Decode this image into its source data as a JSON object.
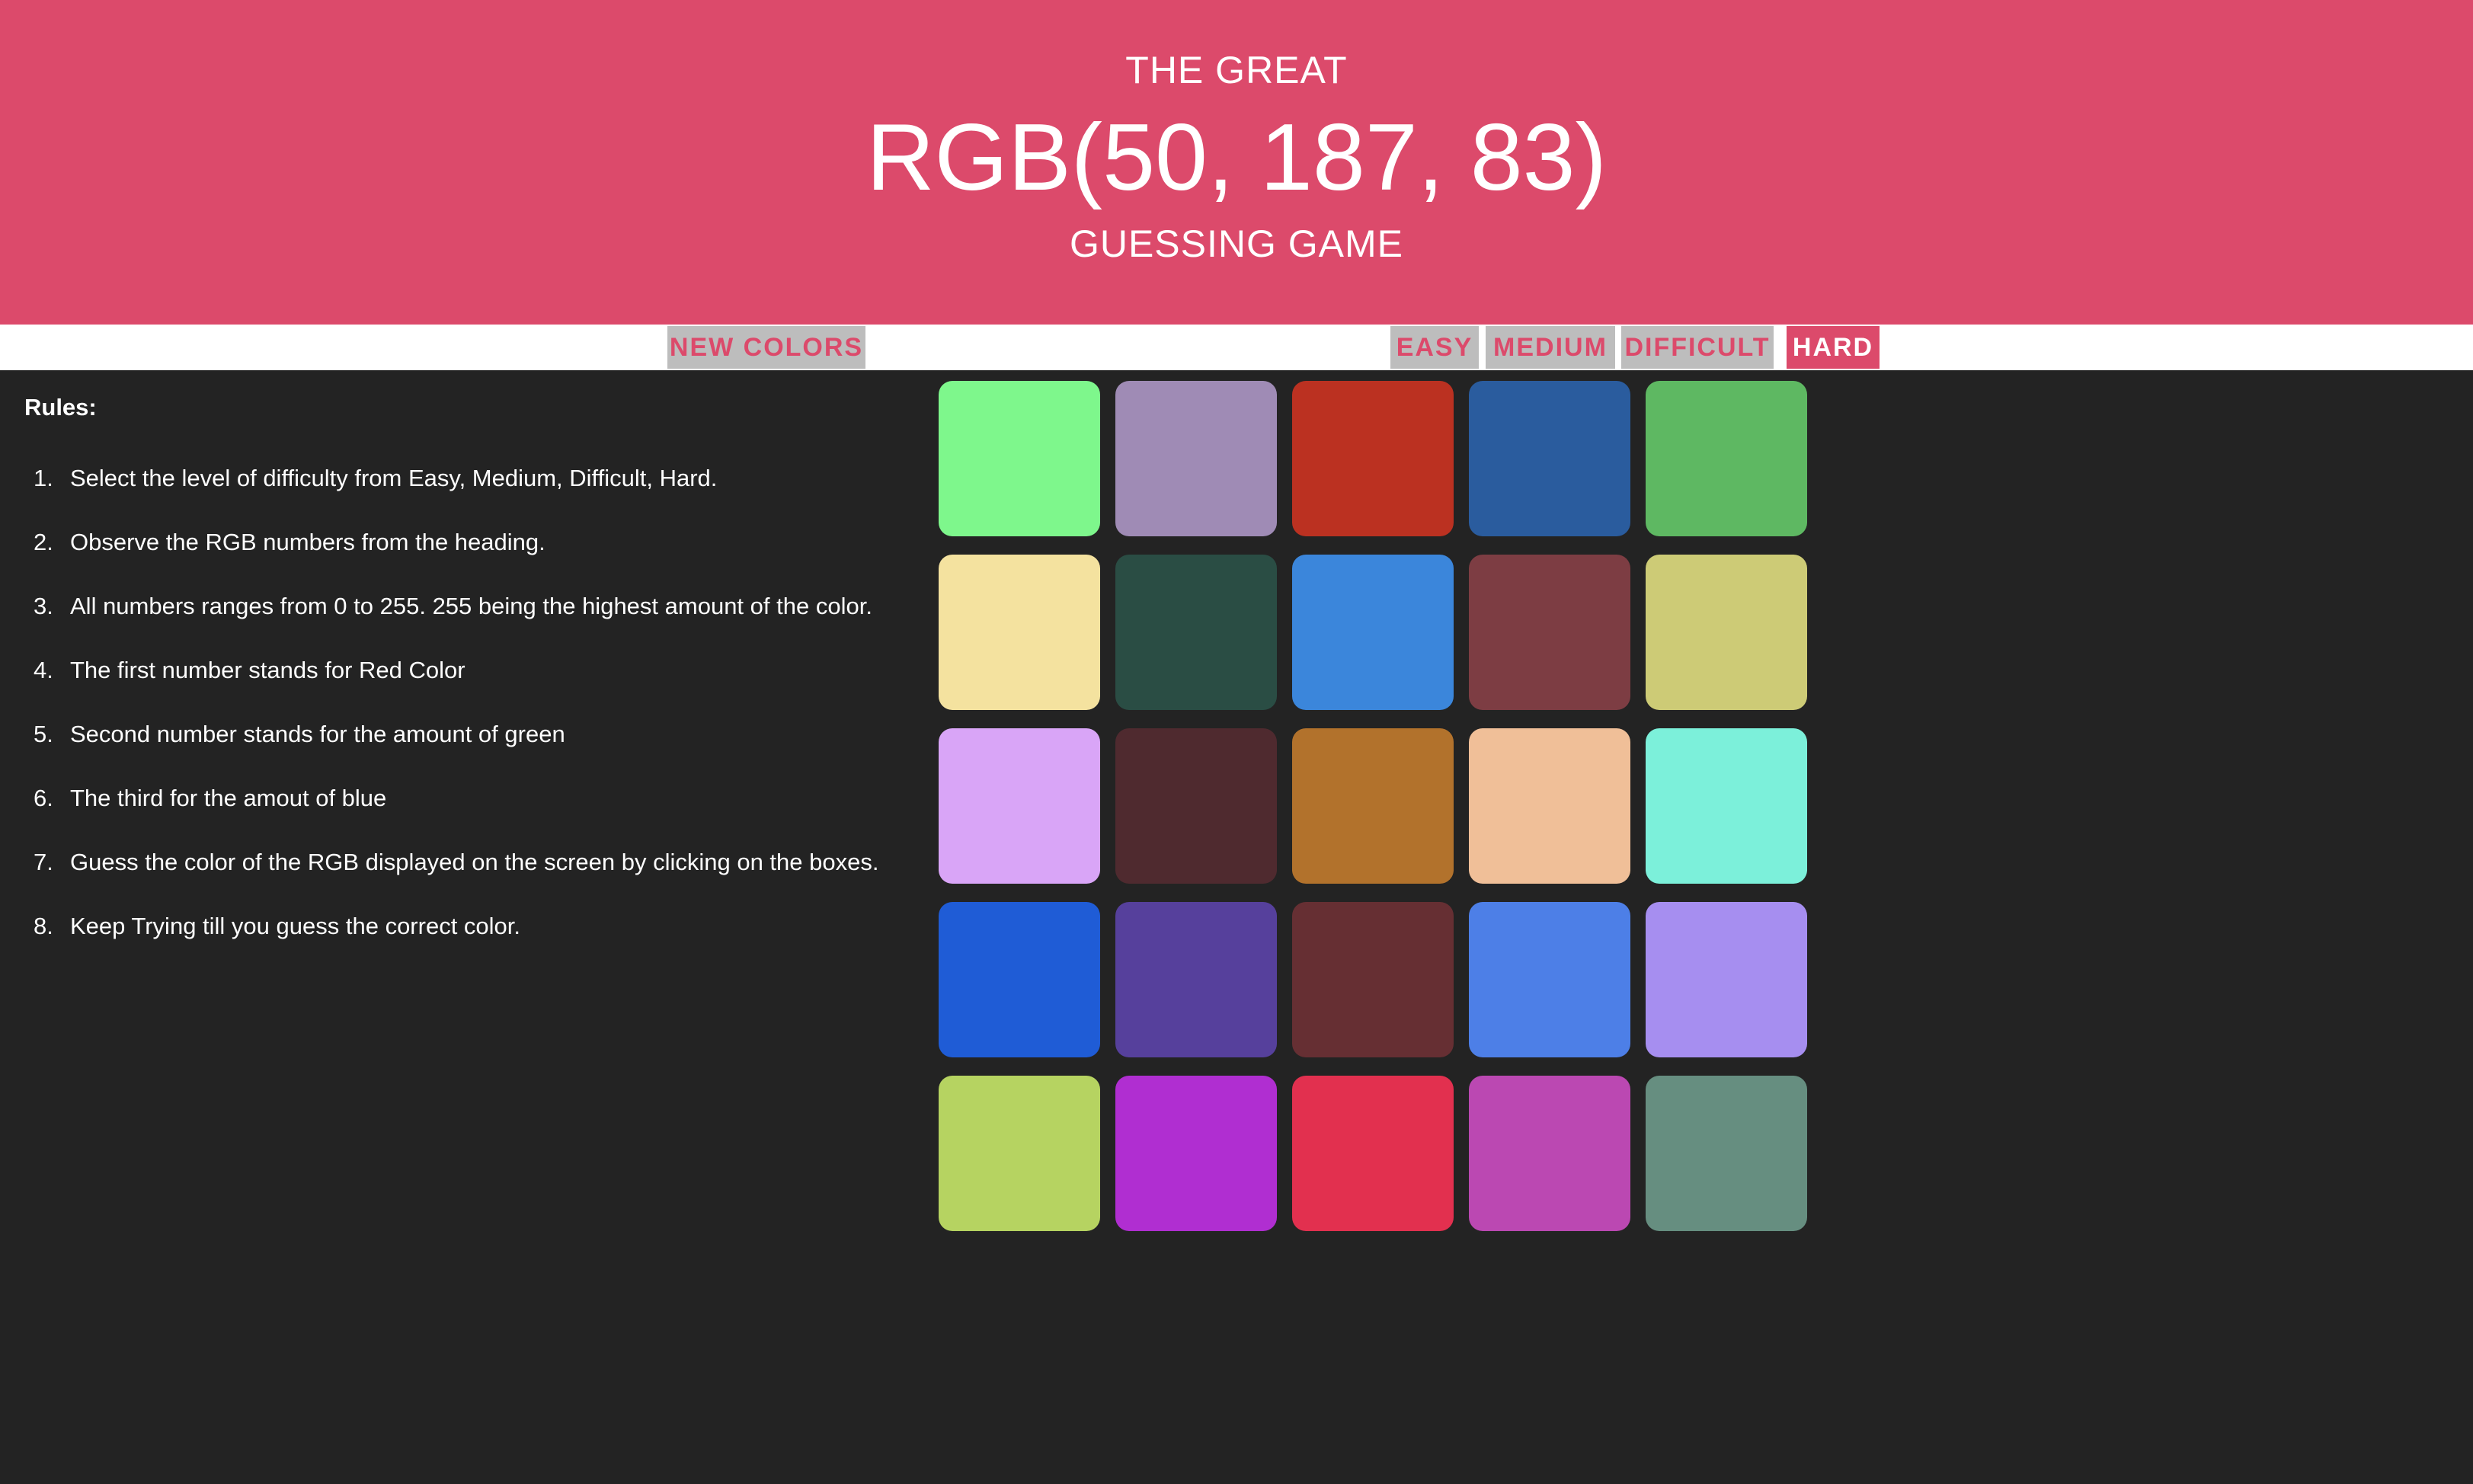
{
  "header": {
    "title_top": "THE GREAT",
    "rgb_display": "RGB(50, 187, 83)",
    "title_bottom": "GUESSING GAME",
    "background": "#dc4a6b"
  },
  "controls": {
    "new_colors_label": "NEW COLORS",
    "levels": [
      {
        "label": "EASY",
        "selected": false
      },
      {
        "label": "MEDIUM",
        "selected": false
      },
      {
        "label": "DIFFICULT",
        "selected": false
      },
      {
        "label": "HARD",
        "selected": true
      }
    ]
  },
  "rules": {
    "title": "Rules:",
    "items": [
      "Select the level of difficulty from Easy, Medium, Difficult, Hard.",
      "Observe the RGB numbers from the heading.",
      "All numbers ranges from 0 to 255. 255 being the highest amount of the color.",
      "The first number stands for Red Color",
      "Second number stands for the amount of green",
      "The third for the amout of blue",
      "Guess the color of the RGB displayed on the screen by clicking on the boxes.",
      "Keep Trying till you guess the correct color."
    ]
  },
  "squares": {
    "columns": 5,
    "colors": [
      "#7ef78c",
      "#9f8bb5",
      "#bb3121",
      "#2a5c9e",
      "#5eb862",
      "#f4e29f",
      "#2a4d44",
      "#3b86db",
      "#7d3d43",
      "#cdcb76",
      "#d9a5f7",
      "#4f2a2f",
      "#b2722c",
      "#f0bf98",
      "#7cf0da",
      "#1f5cd6",
      "#56409c",
      "#662f33",
      "#4d7fe7",
      "#a68ef0",
      "#b6d361",
      "#b02ed1",
      "#e2304f",
      "#bb48b2",
      "#668e80"
    ]
  }
}
